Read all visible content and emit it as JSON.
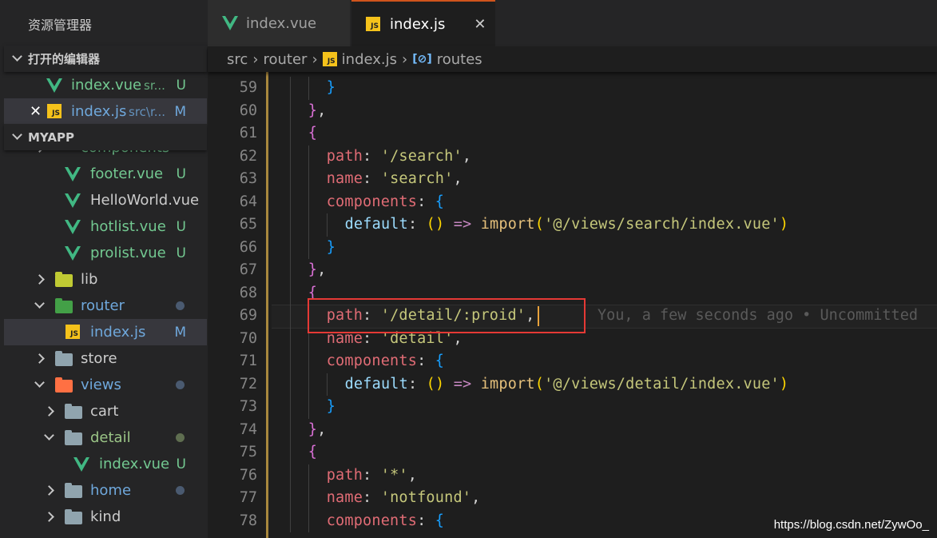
{
  "sidebar": {
    "title": "资源管理器",
    "open_editors_label": "打开的编辑器",
    "open_editors": [
      {
        "name": "index.vue",
        "path": "sr...",
        "status": "U",
        "type": "vue"
      },
      {
        "name": "index.js",
        "path": "src\\r...",
        "status": "M",
        "type": "js"
      }
    ],
    "project_label": "MYAPP",
    "tree": [
      {
        "name": "components",
        "kind": "folder",
        "depth": 1,
        "partial": true
      },
      {
        "name": "footer.vue",
        "kind": "vue",
        "depth": 2,
        "status": "U"
      },
      {
        "name": "HelloWorld.vue",
        "kind": "vue",
        "depth": 2
      },
      {
        "name": "hotlist.vue",
        "kind": "vue",
        "depth": 2,
        "status": "U"
      },
      {
        "name": "prolist.vue",
        "kind": "vue",
        "depth": 2,
        "status": "U"
      },
      {
        "name": "lib",
        "kind": "folder",
        "depth": 1,
        "color": "#c0ca33"
      },
      {
        "name": "router",
        "kind": "folder",
        "depth": 1,
        "open": true,
        "color": "#43a047",
        "dot": "#4a5a70"
      },
      {
        "name": "index.js",
        "kind": "js",
        "depth": 2,
        "status": "M",
        "selected": true
      },
      {
        "name": "store",
        "kind": "folder",
        "depth": 1,
        "color": "#90a4ae"
      },
      {
        "name": "views",
        "kind": "folder",
        "depth": 1,
        "open": true,
        "color": "#ff7043",
        "dot": "#4a5a70"
      },
      {
        "name": "cart",
        "kind": "folder",
        "depth": 2,
        "color": "#90a4ae"
      },
      {
        "name": "detail",
        "kind": "folder",
        "depth": 2,
        "open": true,
        "color": "#90a4ae",
        "dot": "#5f6e50"
      },
      {
        "name": "index.vue",
        "kind": "vue",
        "depth": 3,
        "status": "U"
      },
      {
        "name": "home",
        "kind": "folder",
        "depth": 2,
        "color": "#90a4ae",
        "dot": "#4a5a70"
      },
      {
        "name": "kind",
        "kind": "folder",
        "depth": 2,
        "color": "#90a4ae"
      }
    ]
  },
  "tabs": [
    {
      "label": "index.vue",
      "active": false
    },
    {
      "label": "index.js",
      "active": true,
      "close": "✕"
    }
  ],
  "breadcrumb": [
    "src",
    "router",
    "index.js",
    "routes"
  ],
  "editor": {
    "blame": "You, a few seconds ago • Uncommitted",
    "current_line": 69,
    "lines": [
      {
        "n": 59,
        "c": 6,
        "t": [
          [
            "b2",
            "}"
          ]
        ]
      },
      {
        "n": 60,
        "c": 4,
        "t": [
          [
            "b1",
            "}"
          ],
          [
            "p",
            ","
          ]
        ]
      },
      {
        "n": 61,
        "c": 4,
        "t": [
          [
            "b1",
            "{"
          ]
        ]
      },
      {
        "n": 62,
        "c": 6,
        "t": [
          [
            "key",
            "path"
          ],
          [
            "p",
            ": "
          ],
          [
            "str",
            "'/search'"
          ],
          [
            "p",
            ","
          ]
        ]
      },
      {
        "n": 63,
        "c": 6,
        "t": [
          [
            "key",
            "name"
          ],
          [
            "p",
            ": "
          ],
          [
            "str",
            "'search'"
          ],
          [
            "p",
            ","
          ]
        ]
      },
      {
        "n": 64,
        "c": 6,
        "t": [
          [
            "key",
            "components"
          ],
          [
            "p",
            ": "
          ],
          [
            "b2",
            "{"
          ]
        ]
      },
      {
        "n": 65,
        "c": 8,
        "t": [
          [
            "def",
            "default"
          ],
          [
            "p",
            ": "
          ],
          [
            "b3",
            "()"
          ],
          [
            "p",
            " "
          ],
          [
            "op",
            "=>"
          ],
          [
            "p",
            " "
          ],
          [
            "fn",
            "import"
          ],
          [
            "b3",
            "("
          ],
          [
            "str",
            "'@/views/search/index.vue'"
          ],
          [
            "b3",
            ")"
          ]
        ]
      },
      {
        "n": 66,
        "c": 6,
        "t": [
          [
            "b2",
            "}"
          ]
        ]
      },
      {
        "n": 67,
        "c": 4,
        "t": [
          [
            "b1",
            "}"
          ],
          [
            "p",
            ","
          ]
        ]
      },
      {
        "n": 68,
        "c": 4,
        "t": [
          [
            "b1",
            "{"
          ]
        ]
      },
      {
        "n": 69,
        "c": 6,
        "t": [
          [
            "key",
            "path"
          ],
          [
            "p",
            ": "
          ],
          [
            "str",
            "'/detail/:proid'"
          ],
          [
            "p",
            ","
          ]
        ]
      },
      {
        "n": 70,
        "c": 6,
        "t": [
          [
            "key",
            "name"
          ],
          [
            "p",
            ": "
          ],
          [
            "str",
            "'detail'"
          ],
          [
            "p",
            ","
          ]
        ]
      },
      {
        "n": 71,
        "c": 6,
        "t": [
          [
            "key",
            "components"
          ],
          [
            "p",
            ": "
          ],
          [
            "b2",
            "{"
          ]
        ]
      },
      {
        "n": 72,
        "c": 8,
        "t": [
          [
            "def",
            "default"
          ],
          [
            "p",
            ": "
          ],
          [
            "b3",
            "()"
          ],
          [
            "p",
            " "
          ],
          [
            "op",
            "=>"
          ],
          [
            "p",
            " "
          ],
          [
            "fn",
            "import"
          ],
          [
            "b3",
            "("
          ],
          [
            "str",
            "'@/views/detail/index.vue'"
          ],
          [
            "b3",
            ")"
          ]
        ]
      },
      {
        "n": 73,
        "c": 6,
        "t": [
          [
            "b2",
            "}"
          ]
        ]
      },
      {
        "n": 74,
        "c": 4,
        "t": [
          [
            "b1",
            "}"
          ],
          [
            "p",
            ","
          ]
        ]
      },
      {
        "n": 75,
        "c": 4,
        "t": [
          [
            "b1",
            "{"
          ]
        ]
      },
      {
        "n": 76,
        "c": 6,
        "t": [
          [
            "key",
            "path"
          ],
          [
            "p",
            ": "
          ],
          [
            "str",
            "'*'"
          ],
          [
            "p",
            ","
          ]
        ]
      },
      {
        "n": 77,
        "c": 6,
        "t": [
          [
            "key",
            "name"
          ],
          [
            "p",
            ": "
          ],
          [
            "str",
            "'notfound'"
          ],
          [
            "p",
            ","
          ]
        ]
      },
      {
        "n": 78,
        "c": 6,
        "t": [
          [
            "key",
            "components"
          ],
          [
            "p",
            ": "
          ],
          [
            "b2",
            "{"
          ]
        ]
      }
    ]
  },
  "watermark": "https://blog.csdn.net/ZywOo_",
  "colors": {
    "highlight_box": "#e53935",
    "git_gutter": "#a8873d",
    "tab_active_border": "#d0541c"
  }
}
